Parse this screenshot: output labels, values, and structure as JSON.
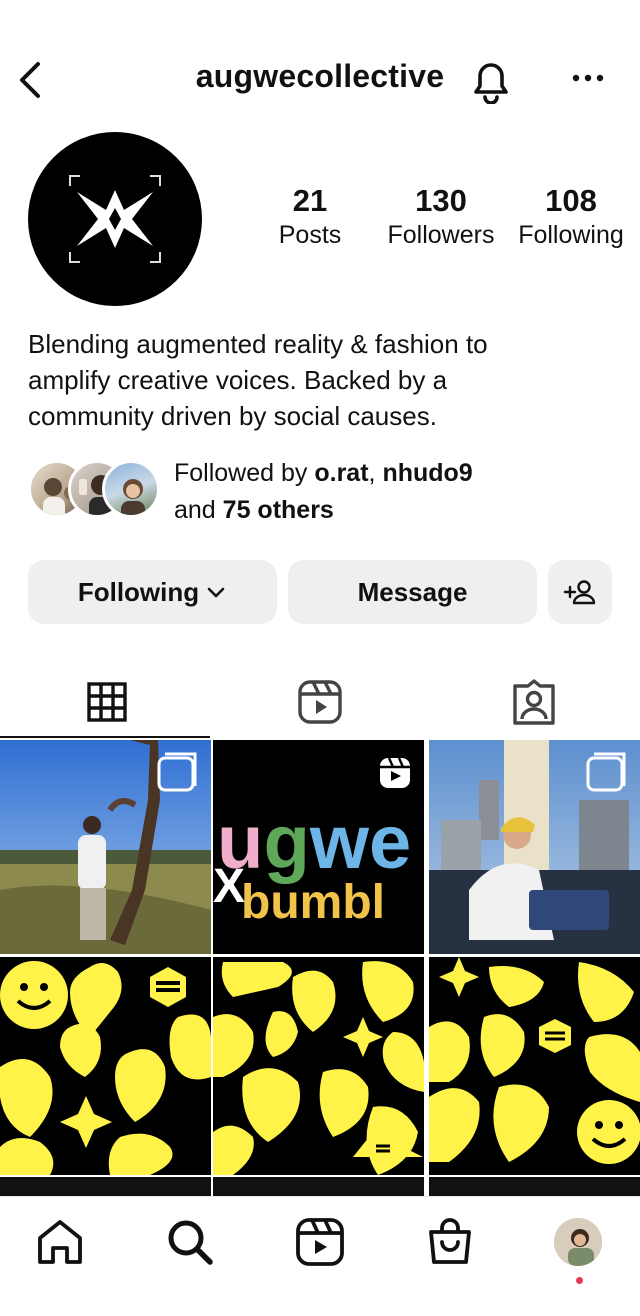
{
  "header": {
    "username": "augwecollective"
  },
  "profile": {
    "stats": [
      {
        "value": "21",
        "label": "Posts"
      },
      {
        "value": "130",
        "label": "Followers"
      },
      {
        "value": "108",
        "label": "Following"
      }
    ],
    "bio": [
      "Blending augmented reality & fashion to",
      "amplify creative voices. Backed by a",
      "community driven by social causes."
    ],
    "followed_by": {
      "prefix": "Followed by ",
      "user1": "o.rat",
      "sep": ", ",
      "user2": "nhudo9",
      "and": "and ",
      "others": "75 others"
    }
  },
  "actions": {
    "following_label": "Following",
    "message_label": "Message"
  },
  "tabs": [
    "grid",
    "reels",
    "tagged"
  ],
  "posts": [
    {
      "type": "photo",
      "badge": "multi"
    },
    {
      "type": "reel",
      "line1": "ugwe",
      "line2": "bumbl",
      "x": "X"
    },
    {
      "type": "photo",
      "badge": "multi"
    },
    {
      "type": "pattern"
    },
    {
      "type": "pattern"
    },
    {
      "type": "pattern"
    }
  ],
  "colors": {
    "accent_yellow": "#fff34a",
    "button_bg": "#efefef",
    "notify_dot": "#e8384f"
  }
}
